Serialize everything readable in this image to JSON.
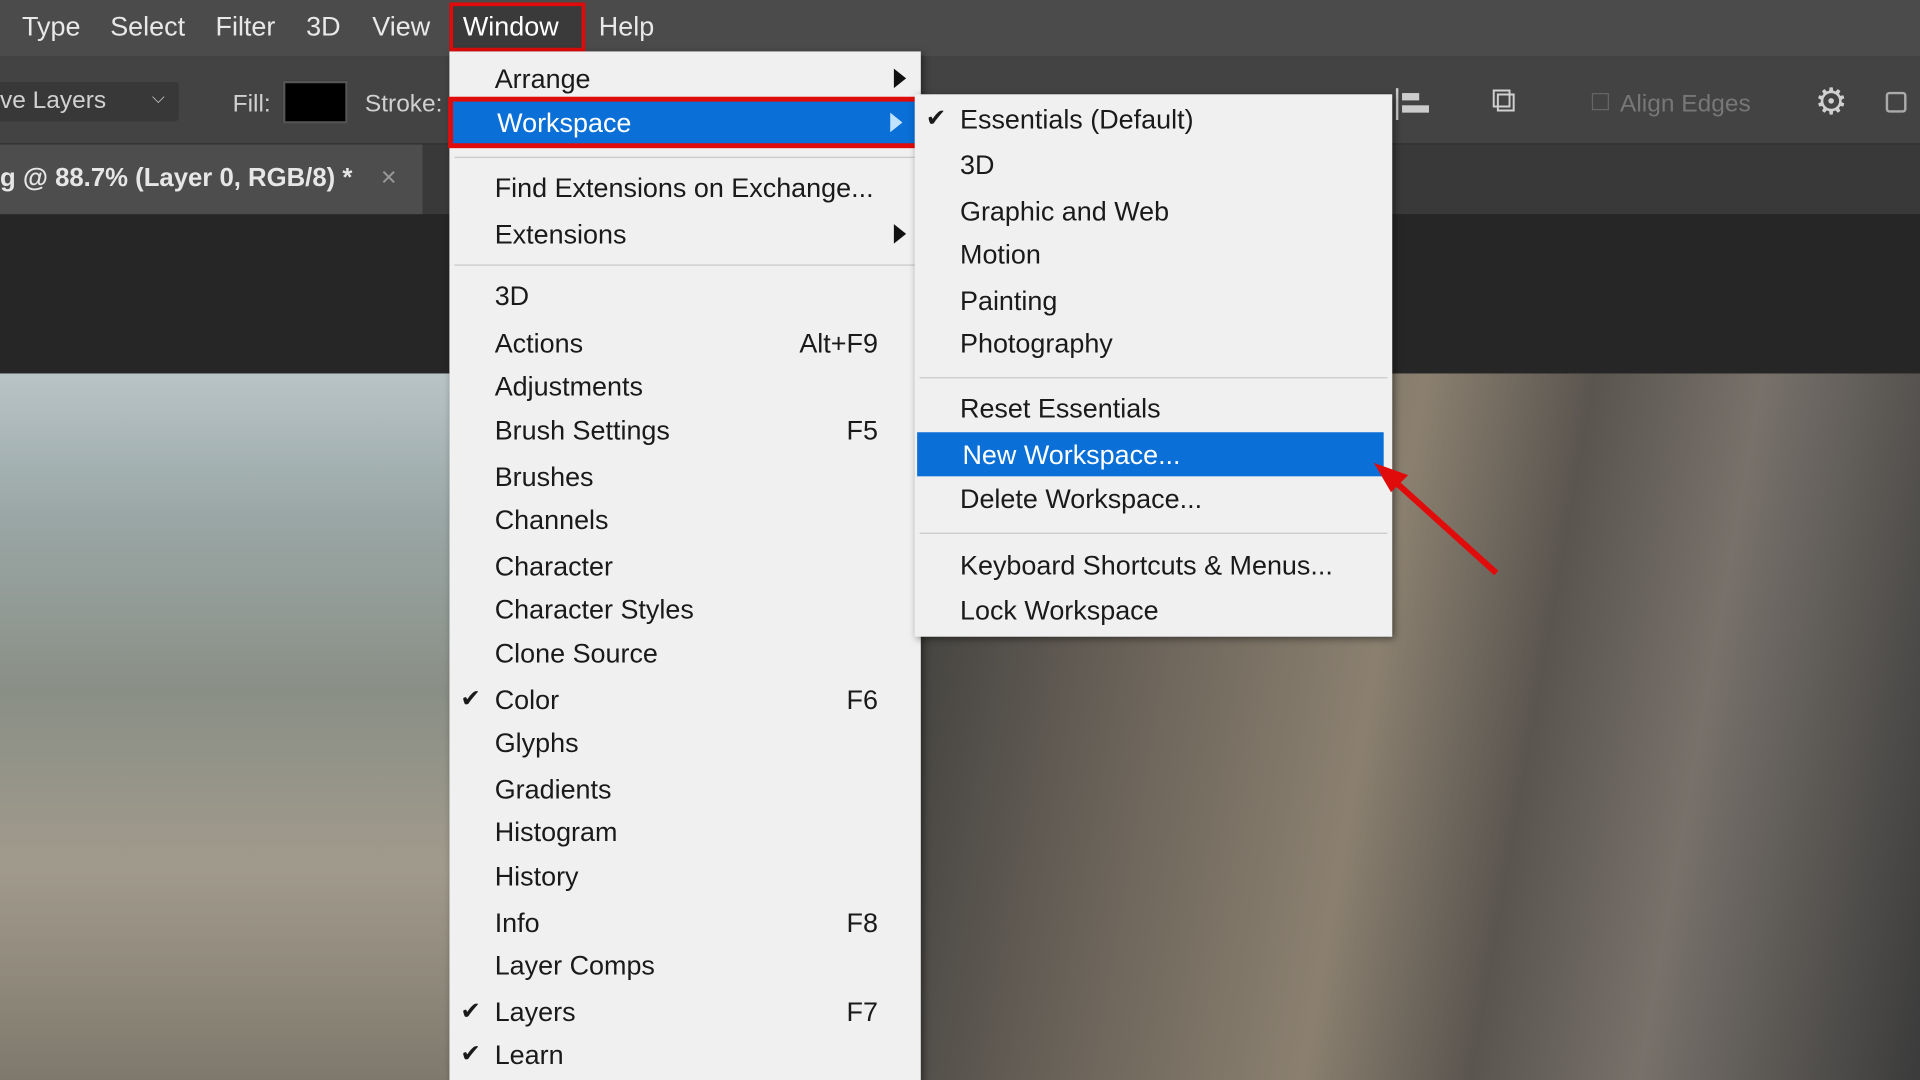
{
  "menubar": {
    "items": [
      "Type",
      "Select",
      "Filter",
      "3D",
      "View",
      "Window",
      "Help"
    ],
    "active": "Window"
  },
  "options": {
    "layers_dropdown": "ve Layers",
    "fill_label": "Fill:",
    "stroke_label": "Stroke:",
    "align_edges": "Align Edges"
  },
  "document_tab": {
    "title": "g @ 88.7% (Layer 0, RGB/8) *",
    "close": "×"
  },
  "window_menu": {
    "top": [
      {
        "label": "Arrange",
        "submenu": true
      },
      {
        "label": "Workspace",
        "submenu": true,
        "highlighted": true
      }
    ],
    "ext": [
      {
        "label": "Find Extensions on Exchange..."
      },
      {
        "label": "Extensions",
        "submenu": true
      }
    ],
    "panels": [
      {
        "label": "3D",
        "shortcut": ""
      },
      {
        "label": "Actions",
        "shortcut": "Alt+F9"
      },
      {
        "label": "Adjustments",
        "shortcut": ""
      },
      {
        "label": "Brush Settings",
        "shortcut": "F5"
      },
      {
        "label": "Brushes",
        "shortcut": ""
      },
      {
        "label": "Channels",
        "shortcut": ""
      },
      {
        "label": "Character",
        "shortcut": ""
      },
      {
        "label": "Character Styles",
        "shortcut": ""
      },
      {
        "label": "Clone Source",
        "shortcut": ""
      },
      {
        "label": "Color",
        "shortcut": "F6",
        "checked": true
      },
      {
        "label": "Glyphs",
        "shortcut": ""
      },
      {
        "label": "Gradients",
        "shortcut": ""
      },
      {
        "label": "Histogram",
        "shortcut": ""
      },
      {
        "label": "History",
        "shortcut": ""
      },
      {
        "label": "Info",
        "shortcut": "F8"
      },
      {
        "label": "Layer Comps",
        "shortcut": ""
      },
      {
        "label": "Layers",
        "shortcut": "F7",
        "checked": true
      },
      {
        "label": "Learn",
        "shortcut": "",
        "checked": true
      }
    ]
  },
  "workspace_submenu": {
    "workspaces": [
      {
        "label": "Essentials (Default)",
        "checked": true
      },
      {
        "label": "3D"
      },
      {
        "label": "Graphic and Web"
      },
      {
        "label": "Motion"
      },
      {
        "label": "Painting"
      },
      {
        "label": "Photography"
      }
    ],
    "actions": [
      {
        "label": "Reset Essentials"
      },
      {
        "label": "New Workspace...",
        "highlighted": true
      },
      {
        "label": "Delete Workspace..."
      }
    ],
    "more": [
      {
        "label": "Keyboard Shortcuts & Menus..."
      },
      {
        "label": "Lock Workspace"
      }
    ]
  },
  "colors": {
    "highlight": "#0a6fd6",
    "annotation_red": "#e00c0c",
    "menu_bg": "#f0f0f0"
  },
  "check_glyph": "✔"
}
